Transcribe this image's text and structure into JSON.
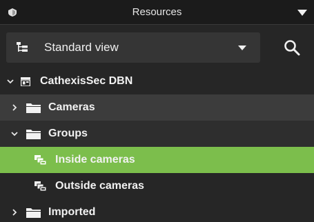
{
  "header": {
    "title": "Resources",
    "app_icon": "shield-icon",
    "menu_icon": "caret-down-icon"
  },
  "toolbar": {
    "view_label": "Standard view",
    "view_icon": "tree-view-icon",
    "search_icon": "search-icon"
  },
  "tree": {
    "root": {
      "label": "CathexisSec DBN",
      "icon": "server-icon",
      "expanded": true
    },
    "items": [
      {
        "label": "Cameras",
        "icon": "folder-icon",
        "expanded": false
      },
      {
        "label": "Groups",
        "icon": "folder-icon",
        "expanded": true
      },
      {
        "label": "Inside cameras",
        "icon": "camera-group-icon",
        "selected": true
      },
      {
        "label": "Outside cameras",
        "icon": "camera-group-icon",
        "selected": false
      },
      {
        "label": "Imported",
        "icon": "folder-icon",
        "expanded": false
      }
    ]
  },
  "colors": {
    "selection": "#7cbe4c",
    "panel_bg": "#262626",
    "header_bg": "#1b1b1b"
  }
}
